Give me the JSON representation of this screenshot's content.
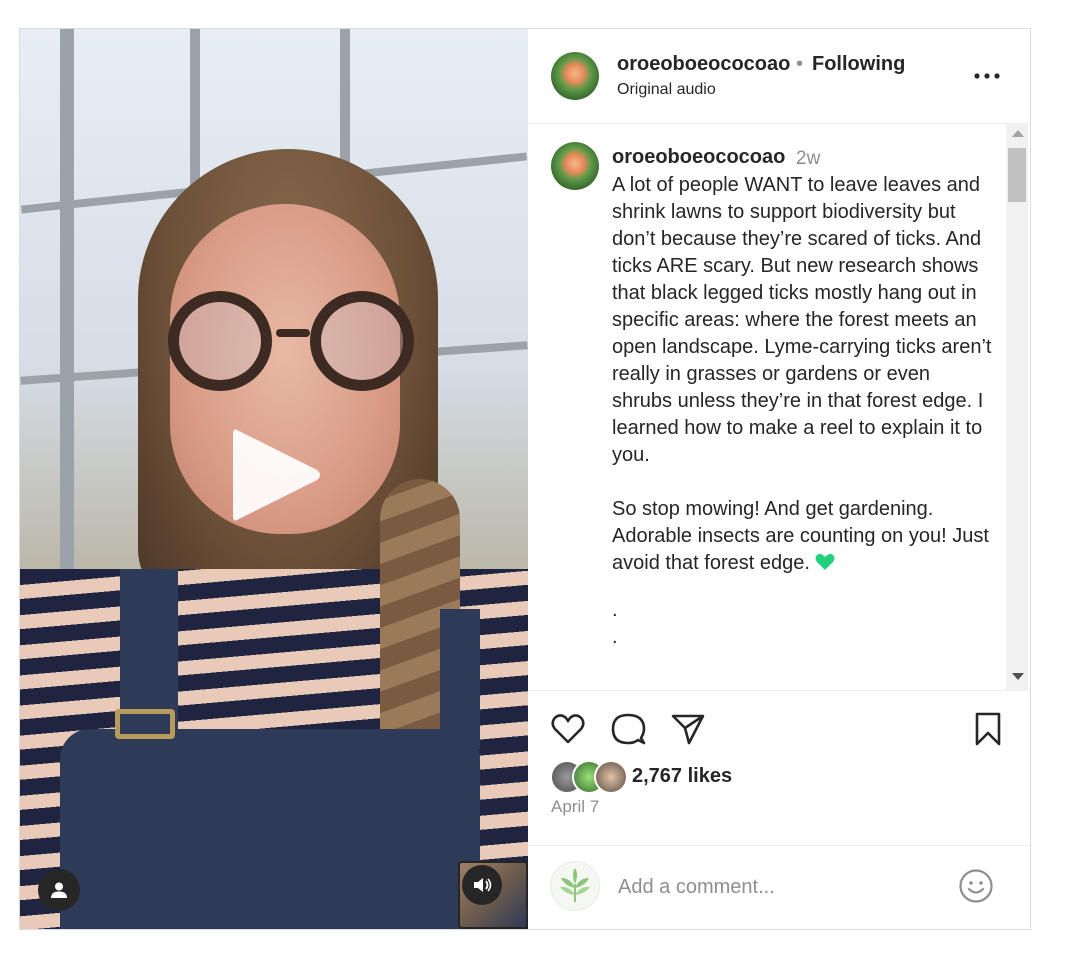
{
  "post": {
    "author": {
      "username": "oroeoboeococoao",
      "separator": "•",
      "follow_status": "Following",
      "audio_label": "Original audio"
    },
    "caption": {
      "username": "oroeoboeococoao",
      "time_ago": "2w",
      "paragraph_1": "A lot of people WANT to leave leaves and shrink lawns to support biodiversity but don’t because they’re scared of ticks. And ticks ARE scary. But new research shows that black legged ticks mostly hang out in specific areas: where the forest meets an open landscape. Lyme-carrying ticks aren’t really in grasses or gardens or even shrubs unless they’re in that forest edge. I learned how to make a reel to explain it to you.",
      "paragraph_2": "So stop mowing! And get gardening. Adorable insects are counting on you! Just avoid that forest edge.",
      "heart_emoji_icon": "green-heart-icon",
      "dot_line_1": ".",
      "dot_line_2": "."
    },
    "stats": {
      "likes": "2,767 likes",
      "date": "April 7"
    },
    "comment_box": {
      "placeholder": "Add a comment..."
    },
    "icons": {
      "more": "more-horizontal-icon",
      "play": "play-icon",
      "user_tag": "user-tag-icon",
      "sound": "speaker-icon",
      "like": "heart-icon",
      "comment": "comment-icon",
      "share": "paper-plane-icon",
      "save": "bookmark-icon",
      "emoji": "smiley-icon"
    },
    "colors": {
      "text": "#262626",
      "muted": "#8e8e8e",
      "heart_emoji": "#1fd17a"
    }
  }
}
